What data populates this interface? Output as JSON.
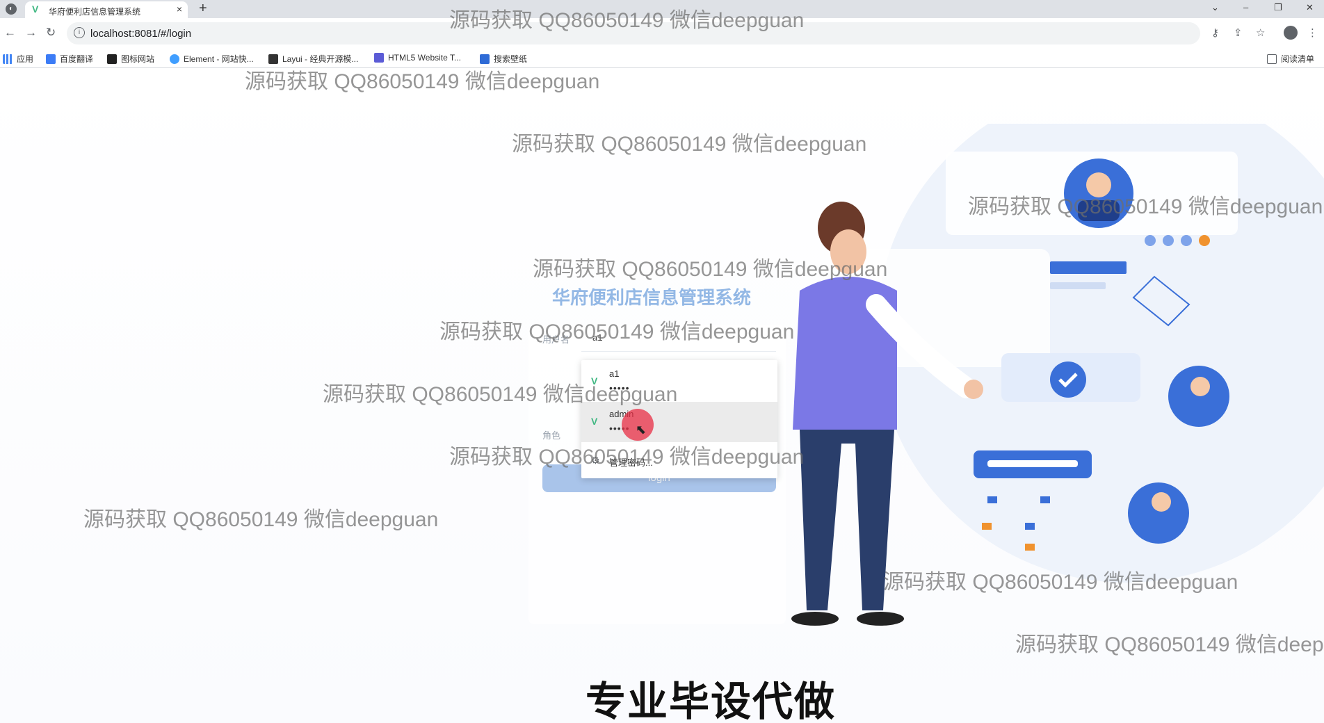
{
  "browser": {
    "tab_title": "华府便利店信息管理系统",
    "new_tab": "+",
    "close": "×",
    "url": "localhost:8081/#/login",
    "bookmarks": [
      "应用",
      "百度翻译",
      "图标网站",
      "Element - 网站快...",
      "Layui - 经典开源模...",
      "HTML5 Website T...",
      "搜索壁纸"
    ],
    "reading_list": "阅读清单"
  },
  "login": {
    "system_title": "华府便利店信息管理系统",
    "username_label": "用户名",
    "username_value": "a1",
    "role_label": "角色",
    "login_button": "login"
  },
  "autofill": {
    "items": [
      {
        "user": "a1",
        "password": "•••••"
      },
      {
        "user": "admin",
        "password": "•••••"
      }
    ],
    "manage_label": "管理密码..."
  },
  "watermark": "源码获取 QQ86050149 微信deepguan",
  "caption": "专业毕设代做",
  "colors": {
    "accent": "#93b8e5",
    "button": "#a9c4ea",
    "vue_green": "#41b883"
  }
}
